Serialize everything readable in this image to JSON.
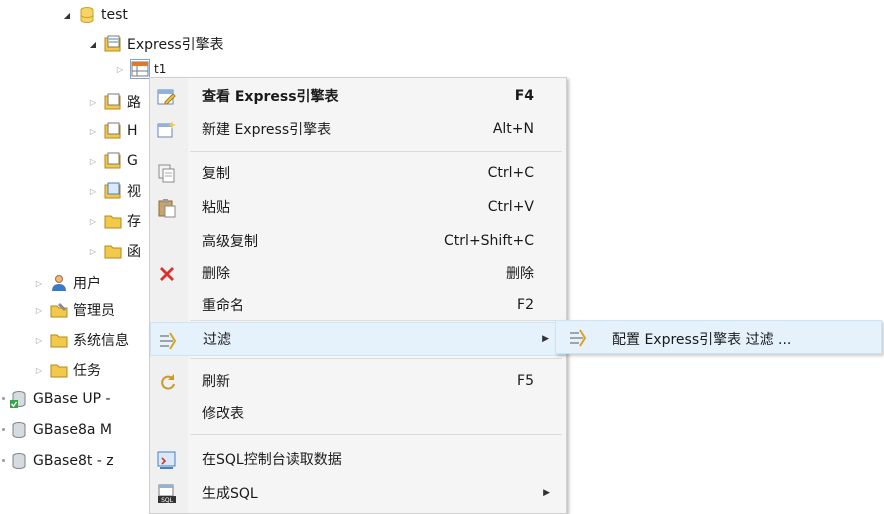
{
  "tree": {
    "test": "test",
    "express_folder": "Express引擎表",
    "table_t1": "t1",
    "peer_1": "路",
    "peer_2": "H",
    "peer_3": "G",
    "peer_4": "视",
    "peer_5": "存",
    "peer_6": "函",
    "users": "用户",
    "admins": "管理员",
    "sysinfo": "系统信息",
    "tasks": "任务",
    "conn_1": "GBase UP -",
    "conn_2": "GBase8a M",
    "conn_3": "GBase8t - z"
  },
  "context_menu": {
    "items": [
      {
        "label": "查看 Express引擎表",
        "shortcut": "F4"
      },
      {
        "label": "新建 Express引擎表",
        "shortcut": "Alt+N"
      },
      {
        "label": "复制",
        "shortcut": "Ctrl+C"
      },
      {
        "label": "粘贴",
        "shortcut": "Ctrl+V"
      },
      {
        "label": "高级复制",
        "shortcut": "Ctrl+Shift+C"
      },
      {
        "label": "删除",
        "shortcut": "删除"
      },
      {
        "label": "重命名",
        "shortcut": "F2"
      },
      {
        "label": "过滤",
        "shortcut": ""
      },
      {
        "label": "刷新",
        "shortcut": "F5"
      },
      {
        "label": "修改表",
        "shortcut": ""
      },
      {
        "label": "在SQL控制台读取数据",
        "shortcut": ""
      },
      {
        "label": "生成SQL",
        "shortcut": ""
      }
    ],
    "submenu_filter": {
      "label": "配置 Express引擎表 过滤 ..."
    }
  },
  "colors": {
    "hover_bg": "#e5f1fb",
    "menu_bg": "#f5f5f5",
    "folder_yellow": "#f3c94c",
    "delete_red": "#d9322a"
  }
}
